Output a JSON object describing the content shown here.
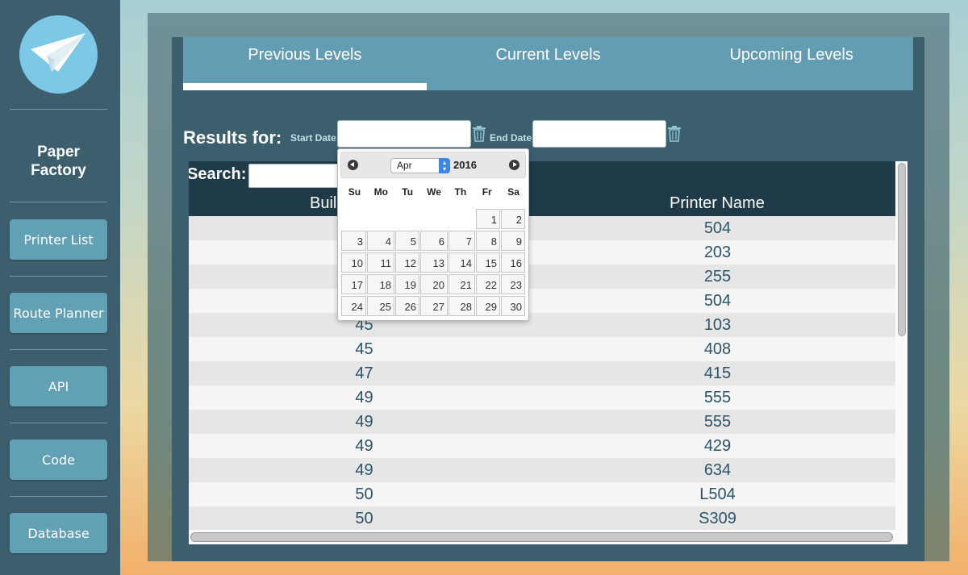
{
  "app": {
    "brand_line1": "Paper",
    "brand_line2": "Factory"
  },
  "sidebar": {
    "items": [
      {
        "label": "Printer List"
      },
      {
        "label": "Route Planner"
      },
      {
        "label": "API"
      },
      {
        "label": "Code"
      },
      {
        "label": "Database"
      }
    ]
  },
  "tabs": [
    {
      "label": "Previous Levels",
      "active": true
    },
    {
      "label": "Current Levels",
      "active": false
    },
    {
      "label": "Upcoming Levels",
      "active": false
    }
  ],
  "filter": {
    "results_label": "Results for:",
    "start_label": "Start Date",
    "end_label": "End Date",
    "start_value": "",
    "end_value": ""
  },
  "table": {
    "search_label": "Search:",
    "search_value": "",
    "columns": [
      "Buil",
      "Printer Name"
    ],
    "rows": [
      [
        "",
        "504"
      ],
      [
        "",
        "203"
      ],
      [
        "",
        "255"
      ],
      [
        "",
        "504"
      ],
      [
        "45",
        "103"
      ],
      [
        "45",
        "408"
      ],
      [
        "47",
        "415"
      ],
      [
        "49",
        "555"
      ],
      [
        "49",
        "555"
      ],
      [
        "49",
        "429"
      ],
      [
        "49",
        "634"
      ],
      [
        "50",
        "L504"
      ],
      [
        "50",
        "S309"
      ]
    ]
  },
  "datepicker": {
    "month": "Apr",
    "year": "2016",
    "weekdays": [
      "Su",
      "Mo",
      "Tu",
      "We",
      "Th",
      "Fr",
      "Sa"
    ],
    "leading_blanks": 5,
    "days": [
      "1",
      "2",
      "3",
      "4",
      "5",
      "6",
      "7",
      "8",
      "9",
      "10",
      "11",
      "12",
      "13",
      "14",
      "15",
      "16",
      "17",
      "18",
      "19",
      "20",
      "21",
      "22",
      "23",
      "24",
      "25",
      "26",
      "27",
      "28",
      "29",
      "30"
    ]
  },
  "colors": {
    "sidebar": "#3d5e6d",
    "tab_bar": "#639db3",
    "table_header": "#1f3b49",
    "row_text": "#2c5468"
  },
  "icons": {
    "logo": "paper-plane-icon",
    "clear_date": "trash-icon",
    "prev_month": "chevron-left-icon",
    "next_month": "chevron-right-icon"
  }
}
